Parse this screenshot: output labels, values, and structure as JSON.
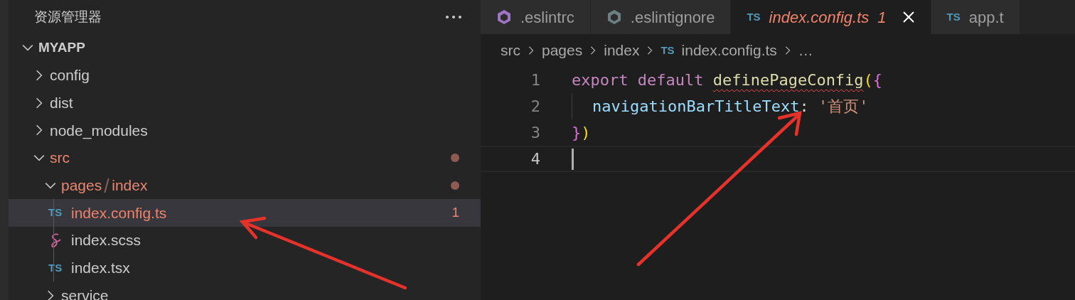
{
  "explorer": {
    "title": "资源管理器",
    "tree": {
      "label": "MYAPP",
      "kind": "root",
      "expanded": true,
      "children": [
        {
          "label": "config",
          "kind": "folder",
          "expanded": false
        },
        {
          "label": "dist",
          "kind": "folder",
          "expanded": false
        },
        {
          "label": "node_modules",
          "kind": "folder",
          "expanded": false
        },
        {
          "label": "src",
          "kind": "folder",
          "expanded": true,
          "modified": true,
          "children": [
            {
              "label": "pages",
              "label_2": "index",
              "kind": "folder",
              "expanded": true,
              "modified": true,
              "children": [
                {
                  "label": "index.config.ts",
                  "kind": "ts",
                  "icon_text": "TS",
                  "selected": true,
                  "error": true,
                  "badge": "1"
                },
                {
                  "label": "index.scss",
                  "kind": "scss",
                  "selected": false
                },
                {
                  "label": "index.tsx",
                  "kind": "ts",
                  "icon_text": "TS",
                  "selected": false
                }
              ]
            },
            {
              "label": "service",
              "kind": "folder",
              "expanded": false
            }
          ]
        }
      ]
    }
  },
  "tabs": [
    {
      "label": ".eslintrc",
      "kind": "eslint",
      "color": "#a074c4",
      "selected": false
    },
    {
      "label": ".eslintignore",
      "kind": "eslint",
      "color": "#6d8086",
      "selected": false
    },
    {
      "label": "index.config.ts",
      "kind": "ts",
      "icon_text": "TS",
      "selected": true,
      "error": true,
      "badge": "1"
    },
    {
      "label": "app.t",
      "kind": "ts",
      "icon_text": "TS",
      "selected": false
    }
  ],
  "breadcrumb": [
    {
      "label": "src"
    },
    {
      "label": "pages"
    },
    {
      "label": "index"
    },
    {
      "label": "index.config.ts",
      "icon_text": "TS"
    },
    {
      "label": "…"
    }
  ],
  "code": [
    {
      "number": "1",
      "active": false,
      "tokens": [
        {
          "text": "export ",
          "kind": "keyword"
        },
        {
          "text": "default ",
          "kind": "keyword"
        },
        {
          "text": "definePageConfig",
          "kind": "function",
          "error": true
        },
        {
          "text": "(",
          "kind": "bracket1"
        },
        {
          "text": "{",
          "kind": "bracket2"
        }
      ]
    },
    {
      "number": "2",
      "active": false,
      "indented": true,
      "tokens": [
        {
          "text": "navigationBarTitleText",
          "kind": "property"
        },
        {
          "text": ": ",
          "kind": "plain"
        },
        {
          "text": "'首页'",
          "kind": "string"
        }
      ]
    },
    {
      "number": "3",
      "active": false,
      "tokens": [
        {
          "text": "}",
          "kind": "bracket2"
        },
        {
          "text": ")",
          "kind": "bracket1"
        }
      ]
    },
    {
      "number": "4",
      "active": true
    }
  ]
}
